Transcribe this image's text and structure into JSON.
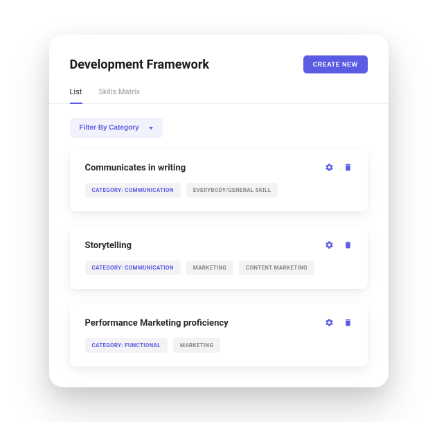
{
  "header": {
    "title": "Development Framework",
    "create_label": "CREATE NEW"
  },
  "tabs": [
    {
      "label": "List",
      "active": true
    },
    {
      "label": "Skills Matrix",
      "active": false
    }
  ],
  "filter": {
    "label": "Filter By Category"
  },
  "items": [
    {
      "title": "Communicates in writing",
      "tags": [
        {
          "text": "CATEGORY: COMMUNICATION",
          "primary": true
        },
        {
          "text": "EVERYBODY/GENERAL SKILL",
          "primary": false
        }
      ]
    },
    {
      "title": "Storytelling",
      "tags": [
        {
          "text": "CATEGORY: COMMUNICATION",
          "primary": true
        },
        {
          "text": "MARKETING",
          "primary": false
        },
        {
          "text": "CONTENT MARKETING",
          "primary": false
        }
      ]
    },
    {
      "title": "Performance Marketing proficiency",
      "tags": [
        {
          "text": "CATEGORY: FUNCTIONAL",
          "primary": true
        },
        {
          "text": "MARKETING",
          "primary": false
        }
      ]
    }
  ],
  "colors": {
    "accent": "#5b5ce4"
  }
}
